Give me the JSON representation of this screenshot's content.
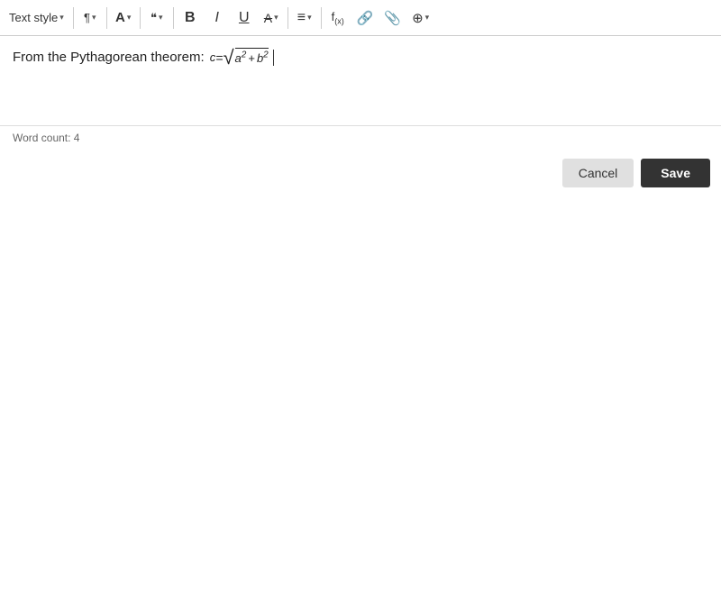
{
  "toolbar": {
    "text_style_label": "Text style",
    "caret": "▾",
    "bold_label": "B",
    "italic_label": "I",
    "underline_label": "U",
    "strikethrough_label": "A",
    "list_label": "≡",
    "function_label": "f(x)",
    "link_label": "🔗",
    "attachment_label": "📎",
    "plus_label": "⊕",
    "font_size_icon": "A",
    "font_color_icon": "A",
    "format_icon": "❝",
    "text_transform_icon": "Aₐ"
  },
  "editor": {
    "content_prefix": "From the Pythagorean theorem:",
    "math_c": "c",
    "math_equals": " = ",
    "math_expression": "√(a² + b²)"
  },
  "word_count": {
    "label": "Word count: 4"
  },
  "buttons": {
    "cancel": "Cancel",
    "save": "Save"
  }
}
